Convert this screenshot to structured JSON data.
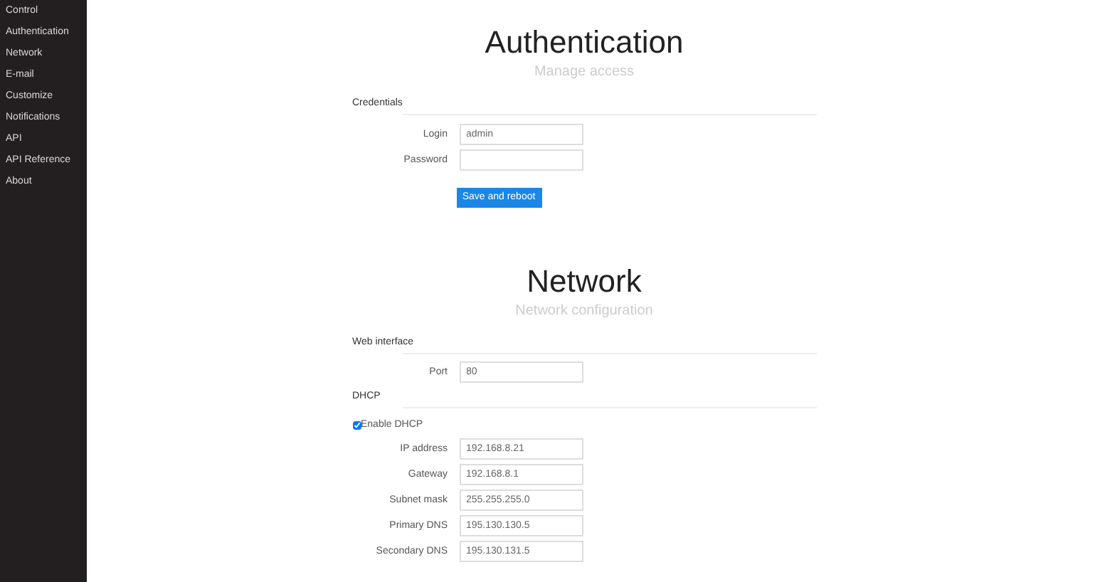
{
  "sidebar": {
    "items": [
      {
        "label": "Control",
        "selected": false
      },
      {
        "label": "Authentication",
        "selected": false
      },
      {
        "label": "Network",
        "selected": false
      },
      {
        "label": "E-mail",
        "selected": false
      },
      {
        "label": "Customize",
        "selected": false
      },
      {
        "label": "Notifications",
        "selected": false
      },
      {
        "label": "API",
        "selected": false
      },
      {
        "label": "API Reference",
        "selected": false
      },
      {
        "label": "About",
        "selected": false
      }
    ]
  },
  "sections": [
    {
      "title": "Authentication",
      "subtitle": "Manage access",
      "groups": [
        {
          "heading": "Credentials",
          "rows": [
            {
              "kind": "field",
              "label": "Login",
              "value": "admin"
            },
            {
              "kind": "field",
              "label": "Password",
              "value": ""
            }
          ]
        }
      ],
      "button": "Save and reboot"
    },
    {
      "title": "Network",
      "subtitle": "Network configuration",
      "groups": [
        {
          "heading": "Web interface",
          "rows": [
            {
              "kind": "field",
              "label": "Port",
              "value": "80"
            }
          ]
        },
        {
          "heading": "DHCP",
          "rows": [
            {
              "kind": "checkbox",
              "label": "Enable DHCP",
              "checked": true
            },
            {
              "kind": "field",
              "label": "IP address",
              "value": "192.168.8.21"
            },
            {
              "kind": "field",
              "label": "Gateway",
              "value": "192.168.8.1"
            },
            {
              "kind": "field",
              "label": "Subnet mask",
              "value": "255.255.255.0"
            },
            {
              "kind": "field",
              "label": "Primary DNS",
              "value": "195.130.130.5"
            },
            {
              "kind": "field",
              "label": "Secondary DNS",
              "value": "195.130.131.5"
            }
          ]
        }
      ]
    }
  ]
}
